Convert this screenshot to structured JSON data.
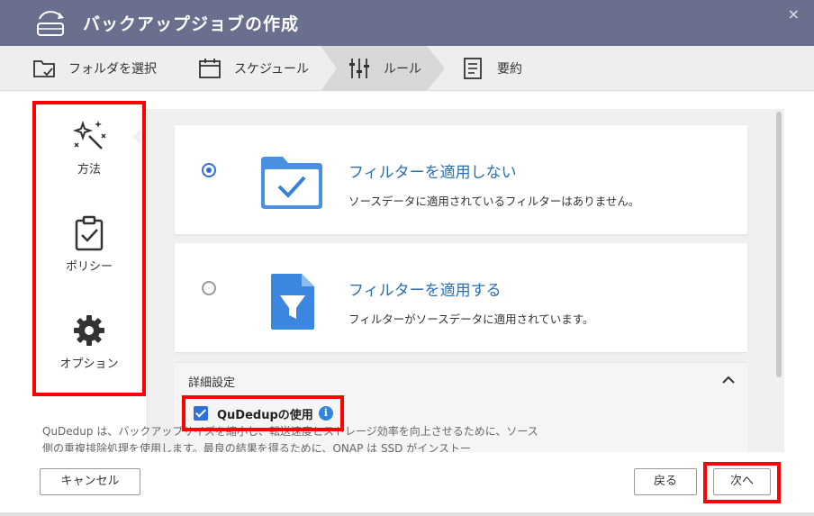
{
  "window": {
    "title": "バックアップジョブの作成",
    "close_label": "×"
  },
  "steps": [
    {
      "label": "フォルダを選択",
      "icon": "folder-check-icon"
    },
    {
      "label": "スケジュール",
      "icon": "calendar-icon"
    },
    {
      "label": "ルール",
      "icon": "sliders-icon"
    },
    {
      "label": "要約",
      "icon": "document-icon"
    }
  ],
  "sidebar": {
    "items": [
      {
        "label": "方法",
        "icon": "magic-wand-icon"
      },
      {
        "label": "ポリシー",
        "icon": "clipboard-check-icon"
      },
      {
        "label": "オプション",
        "icon": "gear-icon"
      }
    ]
  },
  "options": [
    {
      "title": "フィルターを適用しない",
      "desc": "ソースデータに適用されているフィルターはありません。",
      "selected": true,
      "icon": "folder-check-icon"
    },
    {
      "title": "フィルターを適用する",
      "desc": "フィルターがソースデータに適用されています。",
      "selected": false,
      "icon": "file-filter-icon"
    }
  ],
  "advanced": {
    "title": "詳細設定",
    "qudedup_label": "QuDedupの使用",
    "qudedup_checked": true,
    "info_glyph": "i",
    "desc": "QuDedup は、バックアップサイズを縮小し、転送速度とストレージ効率を向上させるために、ソース側の重複排除処理を使用します。最良の結果を得るために、QNAP は SSD がインストー"
  },
  "footer": {
    "cancel_label": "キャンセル",
    "back_label": "戻る",
    "next_label": "次へ"
  },
  "colors": {
    "titlebar": "#6a6f8e",
    "accent": "#2f6fd6",
    "link": "#2a6fb0",
    "highlight": "#ff0000"
  }
}
